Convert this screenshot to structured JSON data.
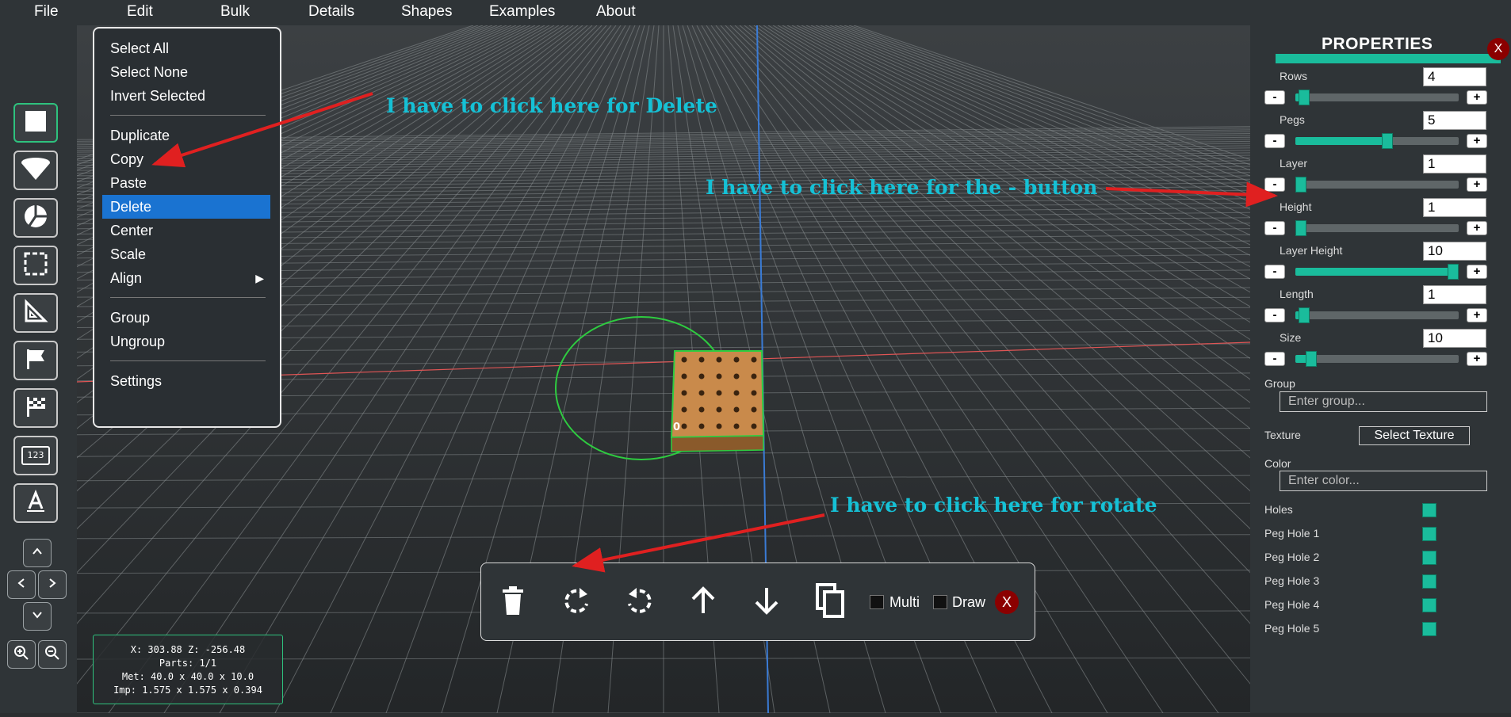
{
  "menubar": {
    "items": [
      "File",
      "Edit",
      "Bulk",
      "Details",
      "Shapes",
      "Examples",
      "About"
    ]
  },
  "edit_menu": {
    "groups": [
      [
        "Select All",
        "Select None",
        "Invert Selected"
      ],
      [
        "Duplicate",
        "Copy",
        "Paste",
        "Delete",
        "Center",
        "Scale",
        "Align"
      ],
      [
        "Group",
        "Ungroup"
      ],
      [
        "Settings"
      ]
    ],
    "selected": "Delete",
    "submenu_arrow": "▶"
  },
  "toolbar": {
    "tools": [
      "square-icon",
      "cone-icon",
      "pie-chart-icon",
      "selection-icon",
      "triangle-ruler-icon",
      "flag-icon",
      "checkered-flag-icon",
      "number-label-icon",
      "text-icon"
    ],
    "number_label_text": "123",
    "nav": [
      "chevron-up-icon",
      "chevron-left-icon",
      "chevron-right-icon",
      "chevron-down-icon"
    ],
    "zoom": [
      "zoom-in-icon",
      "zoom-out-icon"
    ]
  },
  "scene": {
    "object_label": "0",
    "colors": {
      "grid": "#8a8f92",
      "axis_x": "#e05555",
      "axis_z": "#3a7bd5",
      "selection": "#2ecc40",
      "wood": "#c98a4b"
    }
  },
  "info": {
    "position": "X: 303.88 Z: -256.48",
    "parts": "Parts: 1/1",
    "met": "Met: 40.0 x 40.0 x 10.0",
    "imp": "Imp: 1.575 x 1.575 x 0.394"
  },
  "action_bar": {
    "icons": [
      "trash-icon",
      "rotate-clockwise-icon",
      "rotate-counterclockwise-icon",
      "arrow-up-icon",
      "arrow-down-icon",
      "copy-icon"
    ],
    "multi_label": "Multi",
    "draw_label": "Draw",
    "close_label": "X"
  },
  "properties": {
    "title": "PROPERTIES",
    "close_label": "X",
    "sliders": [
      {
        "label": "Rows",
        "value": "4",
        "level": 0.02
      },
      {
        "label": "Pegs",
        "value": "5",
        "level": 0.57
      },
      {
        "label": "Layer",
        "value": "1",
        "level": 0.0
      },
      {
        "label": "Height",
        "value": "1",
        "level": 0.0
      },
      {
        "label": "Layer Height",
        "value": "10",
        "level": 1.0
      },
      {
        "label": "Length",
        "value": "1",
        "level": 0.02
      },
      {
        "label": "Size",
        "value": "10",
        "level": 0.07
      }
    ],
    "minus": "-",
    "plus": "+",
    "group_label": "Group",
    "group_placeholder": "Enter group...",
    "texture_label": "Texture",
    "texture_button": "Select Texture",
    "color_label": "Color",
    "color_placeholder": "Enter color...",
    "checks": [
      "Holes",
      "Peg Hole 1",
      "Peg Hole 2",
      "Peg Hole 3",
      "Peg Hole 4",
      "Peg Hole 5"
    ],
    "accent": "#1abc9c"
  },
  "annotations": {
    "delete_note": "I have to click here for Delete",
    "minus_note": "I have to click here for the - button",
    "rotate_note": "I have to click here for rotate",
    "color": "#15c1d6",
    "arrow_color": "#e02020"
  }
}
